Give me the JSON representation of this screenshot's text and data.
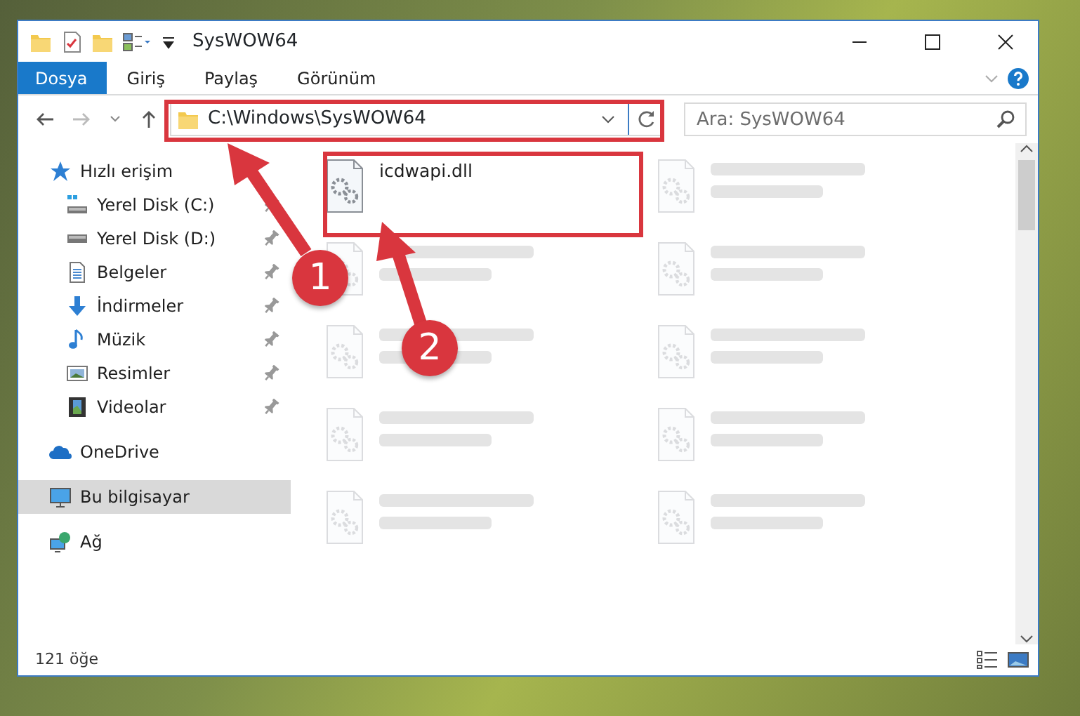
{
  "window": {
    "title": "SysWOW64"
  },
  "ribbon_tabs": [
    {
      "label": "Dosya",
      "selected": true
    },
    {
      "label": "Giriş",
      "selected": false
    },
    {
      "label": "Paylaş",
      "selected": false
    },
    {
      "label": "Görünüm",
      "selected": false
    }
  ],
  "address": {
    "path": "C:\\Windows\\SysWOW64"
  },
  "search": {
    "placeholder": "Ara: SysWOW64"
  },
  "navigation": [
    {
      "label": "Hızlı erişim",
      "kind": "star",
      "selected": false,
      "children": [
        {
          "label": "Yerel Disk (C:)",
          "kind": "system-disk",
          "pinned": true,
          "selected": false
        },
        {
          "label": "Yerel Disk (D:)",
          "kind": "disk",
          "pinned": true,
          "selected": false
        },
        {
          "label": "Belgeler",
          "kind": "documents",
          "pinned": true,
          "selected": false
        },
        {
          "label": "İndirmeler",
          "kind": "downloads",
          "pinned": true,
          "selected": false
        },
        {
          "label": "Müzik",
          "kind": "music",
          "pinned": true,
          "selected": false
        },
        {
          "label": "Resimler",
          "kind": "pictures",
          "pinned": true,
          "selected": false
        },
        {
          "label": "Videolar",
          "kind": "videos",
          "pinned": true,
          "selected": false
        }
      ]
    },
    {
      "label": "OneDrive",
      "kind": "cloud",
      "selected": false
    },
    {
      "label": "Bu bilgisayar",
      "kind": "computer",
      "selected": true
    },
    {
      "label": "Ağ",
      "kind": "network",
      "selected": false
    }
  ],
  "files": [
    {
      "kind": "file",
      "name": "icdwapi.dll",
      "highlighted": true
    },
    {
      "kind": "blurred"
    },
    {
      "kind": "blurred"
    },
    {
      "kind": "blurred"
    },
    {
      "kind": "blurred"
    },
    {
      "kind": "blurred"
    },
    {
      "kind": "blurred"
    },
    {
      "kind": "blurred"
    },
    {
      "kind": "blurred"
    },
    {
      "kind": "blurred"
    }
  ],
  "callouts": [
    {
      "label": "1"
    },
    {
      "label": "2"
    }
  ],
  "status_bar": {
    "count": "121 öğe"
  }
}
